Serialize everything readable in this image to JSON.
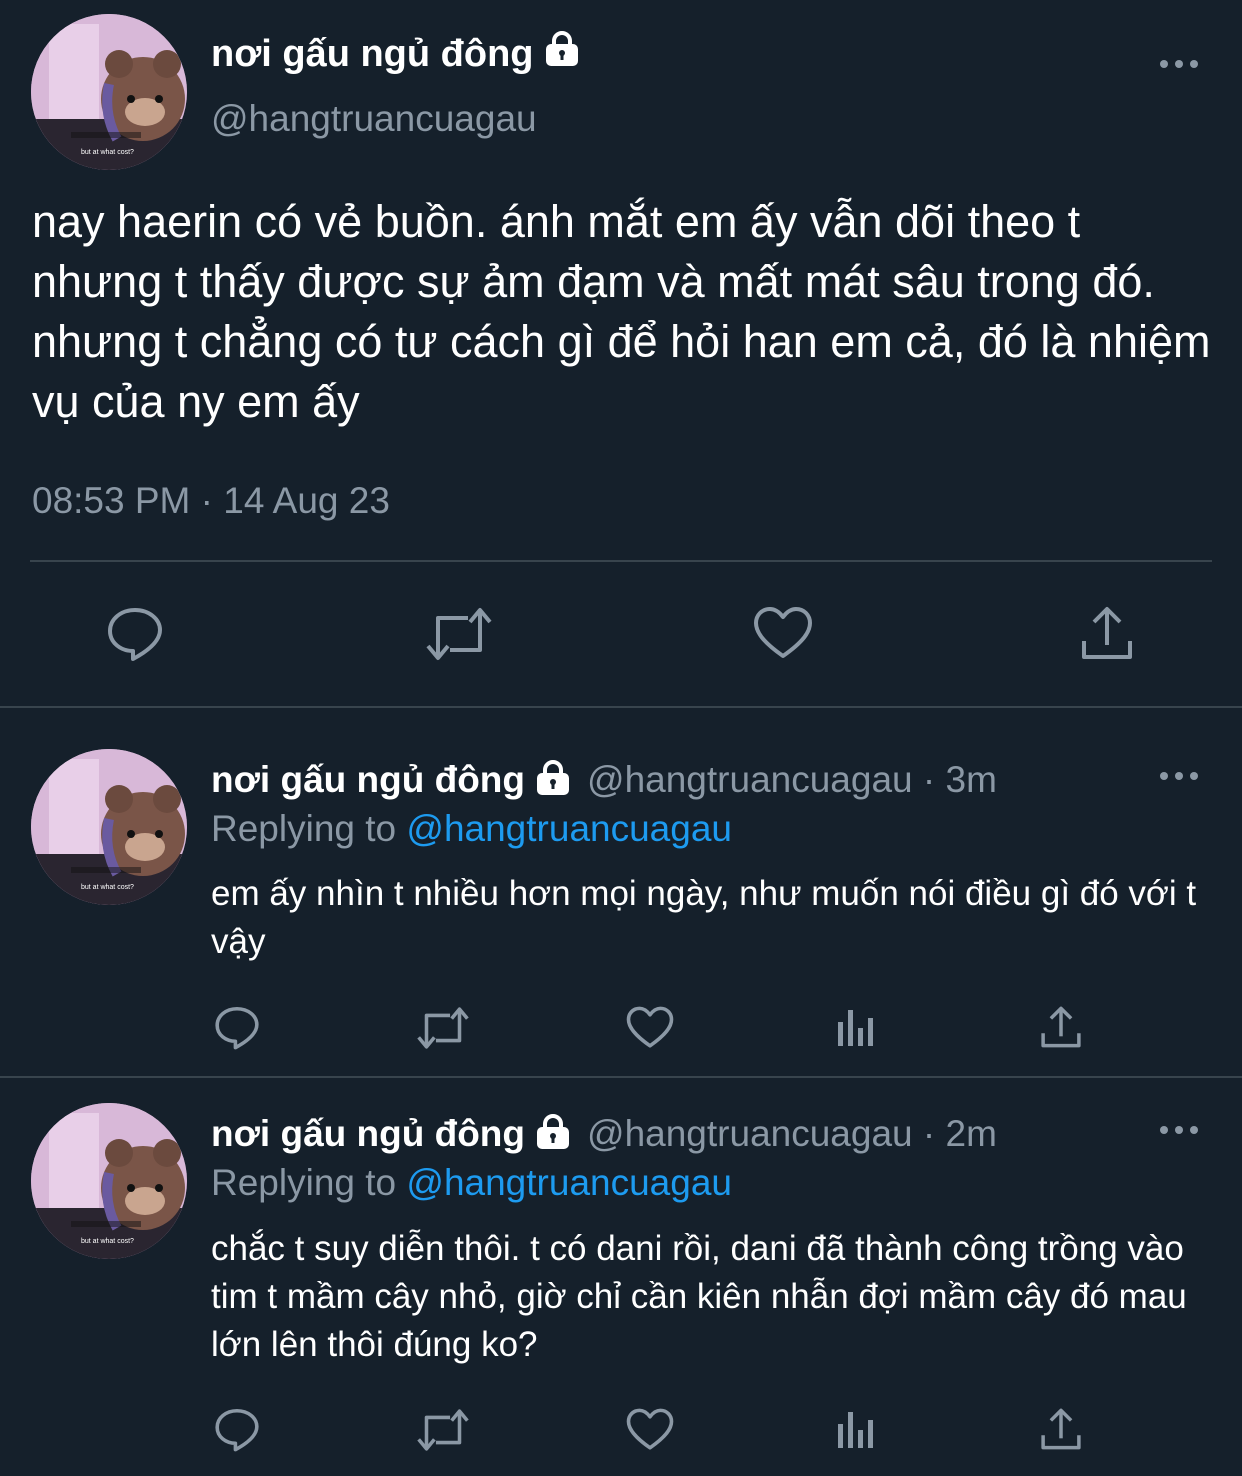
{
  "main_tweet": {
    "display_name": "nơi gấu ngủ đông",
    "handle": "@hangtruancuagau",
    "text": "nay haerin có vẻ buồn. ánh mắt em ấy vẫn dõi theo t nhưng t thấy được sự ảm đạm và mất mát sâu trong đó. nhưng t chẳng có tư cách gì để hỏi han em cả, đó là nhiệm vụ của ny em ấy",
    "timestamp": "08:53 PM · 14 Aug 23",
    "avatar_caption": "but at what cost?",
    "icons": [
      "lock-icon",
      "more-icon",
      "reply-icon",
      "retweet-icon",
      "like-icon",
      "share-icon"
    ]
  },
  "replies": [
    {
      "display_name": "nơi gấu ngủ đông",
      "handle_time": "@hangtruancuagau · 3m",
      "replying_label": "Replying to",
      "replying_mention": "@hangtruancuagau",
      "text": "em ấy nhìn t nhiều hơn mọi ngày, như muốn nói điều gì đó với t vậy",
      "avatar_caption": "but at what cost?"
    },
    {
      "display_name": "nơi gấu ngủ đông",
      "handle_time": "@hangtruancuagau · 2m",
      "replying_label": "Replying to",
      "replying_mention": "@hangtruancuagau",
      "text": "chắc t suy diễn thôi. t có dani rồi, dani đã thành công trồng vào tim t mầm cây nhỏ, giờ chỉ cần kiên nhẫn đợi mầm cây đó mau lớn lên thôi đúng ko?",
      "avatar_caption": "but at what cost?"
    }
  ],
  "colors": {
    "background": "#15202b",
    "secondary_text": "#8b98a5",
    "mention": "#1d9bf0",
    "divider": "#38444d",
    "icon": "#8b98a5"
  }
}
